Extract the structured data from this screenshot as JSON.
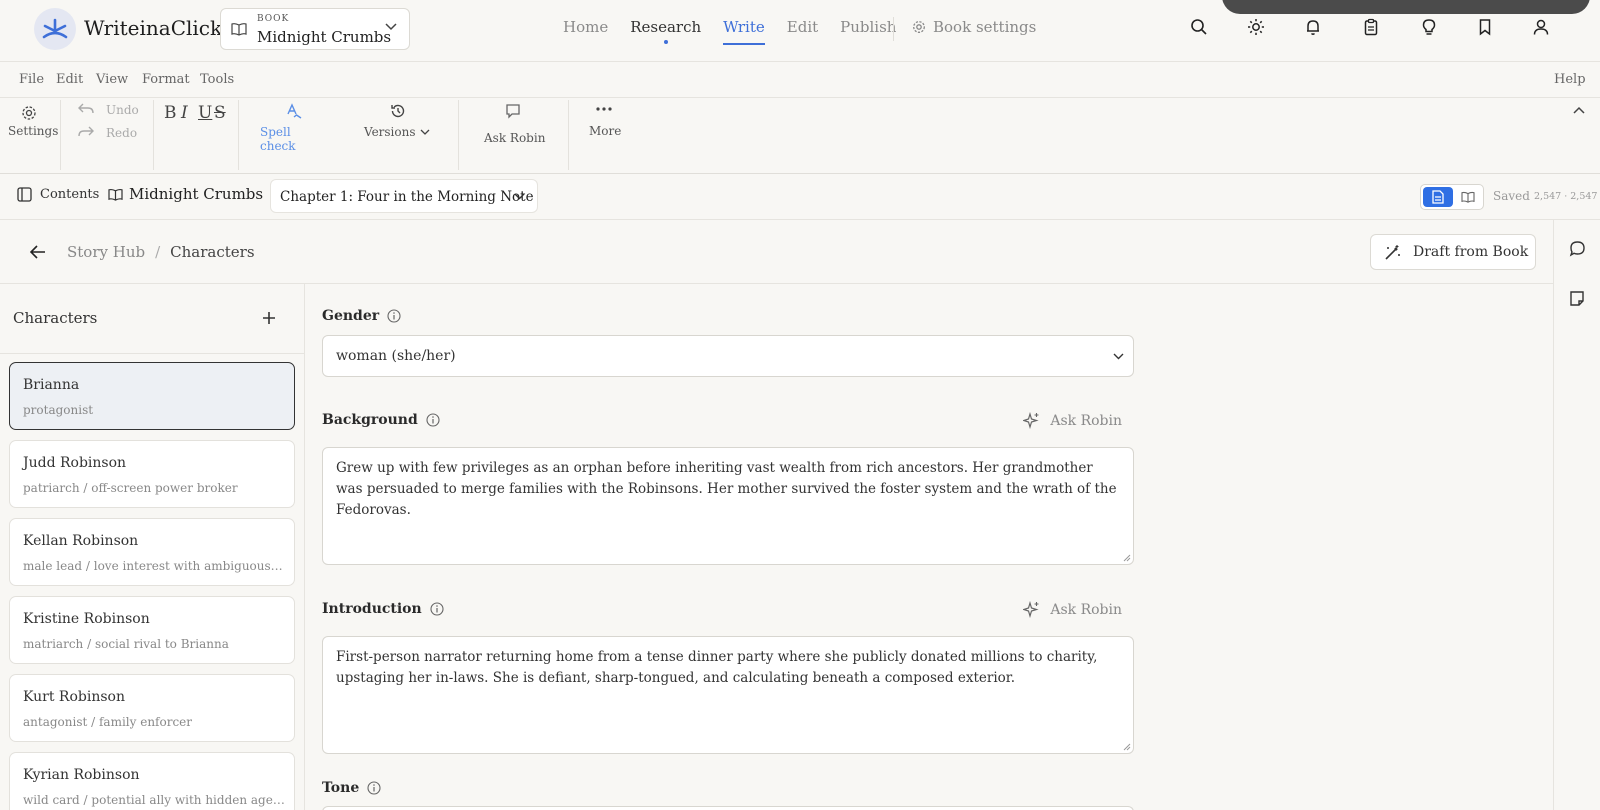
{
  "app": {
    "name": "WriteinaClick"
  },
  "book_picker": {
    "small_label": "BOOK",
    "name": "Midnight Crumbs"
  },
  "nav": {
    "home": "Home",
    "research": "Research",
    "write": "Write",
    "edit": "Edit",
    "publish": "Publish",
    "book_settings": "Book settings"
  },
  "top_icons": [
    "search-icon",
    "sun-icon",
    "bell-icon",
    "clipboard-icon",
    "lightbulb-icon",
    "bookmark-icon",
    "user-icon"
  ],
  "menu": {
    "file": "File",
    "edit": "Edit",
    "view": "View",
    "format": "Format",
    "tools": "Tools",
    "help": "Help"
  },
  "ribbon": {
    "settings": "Settings",
    "undo": "Undo",
    "redo": "Redo",
    "format_letters": {
      "bold": "B",
      "italic": "I",
      "underline": "U",
      "strike": "S"
    },
    "spell_check": "Spell check",
    "versions": "Versions",
    "ask_robin": "Ask Robin",
    "more": "More"
  },
  "chapter_bar": {
    "contents": "Contents",
    "book_name": "Midnight Crumbs",
    "chapter": "Chapter 1: Four in the Morning Note",
    "saved": "Saved",
    "count": "2,547 · 2,547"
  },
  "breadcrumb": {
    "root": "Story Hub",
    "sep": "/",
    "current": "Characters"
  },
  "draft_button": "Draft from Book",
  "characters_panel": {
    "title": "Characters",
    "items": [
      {
        "name": "Brianna",
        "role": "protagonist",
        "active": true
      },
      {
        "name": "Judd Robinson",
        "role": "patriarch / off-screen power broker"
      },
      {
        "name": "Kellan Robinson",
        "role": "male lead / love interest with ambiguous lo..."
      },
      {
        "name": "Kristine Robinson",
        "role": "matriarch / social rival to Brianna"
      },
      {
        "name": "Kurt Robinson",
        "role": "antagonist / family enforcer"
      },
      {
        "name": "Kyrian Robinson",
        "role": "wild card / potential ally with hidden agenda"
      }
    ]
  },
  "form": {
    "gender": {
      "label": "Gender",
      "value": "woman (she/her)"
    },
    "background": {
      "label": "Background",
      "ask": "Ask Robin",
      "value": "Grew up with few privileges as an orphan before inheriting vast wealth from rich ancestors. Her grandmother was persuaded to merge families with the Robinsons. Her mother survived the foster system and the wrath of the Fedorovas."
    },
    "introduction": {
      "label": "Introduction",
      "ask": "Ask Robin",
      "value": "First-person narrator returning home from a tense dinner party where she publicly donated millions to charity, upstaging her in-laws. She is defiant, sharp-tongued, and calculating beneath a composed exterior."
    },
    "tone": {
      "label": "Tone"
    }
  },
  "colors": {
    "accent": "#3e6fd8",
    "background": "#f8f7f4"
  }
}
